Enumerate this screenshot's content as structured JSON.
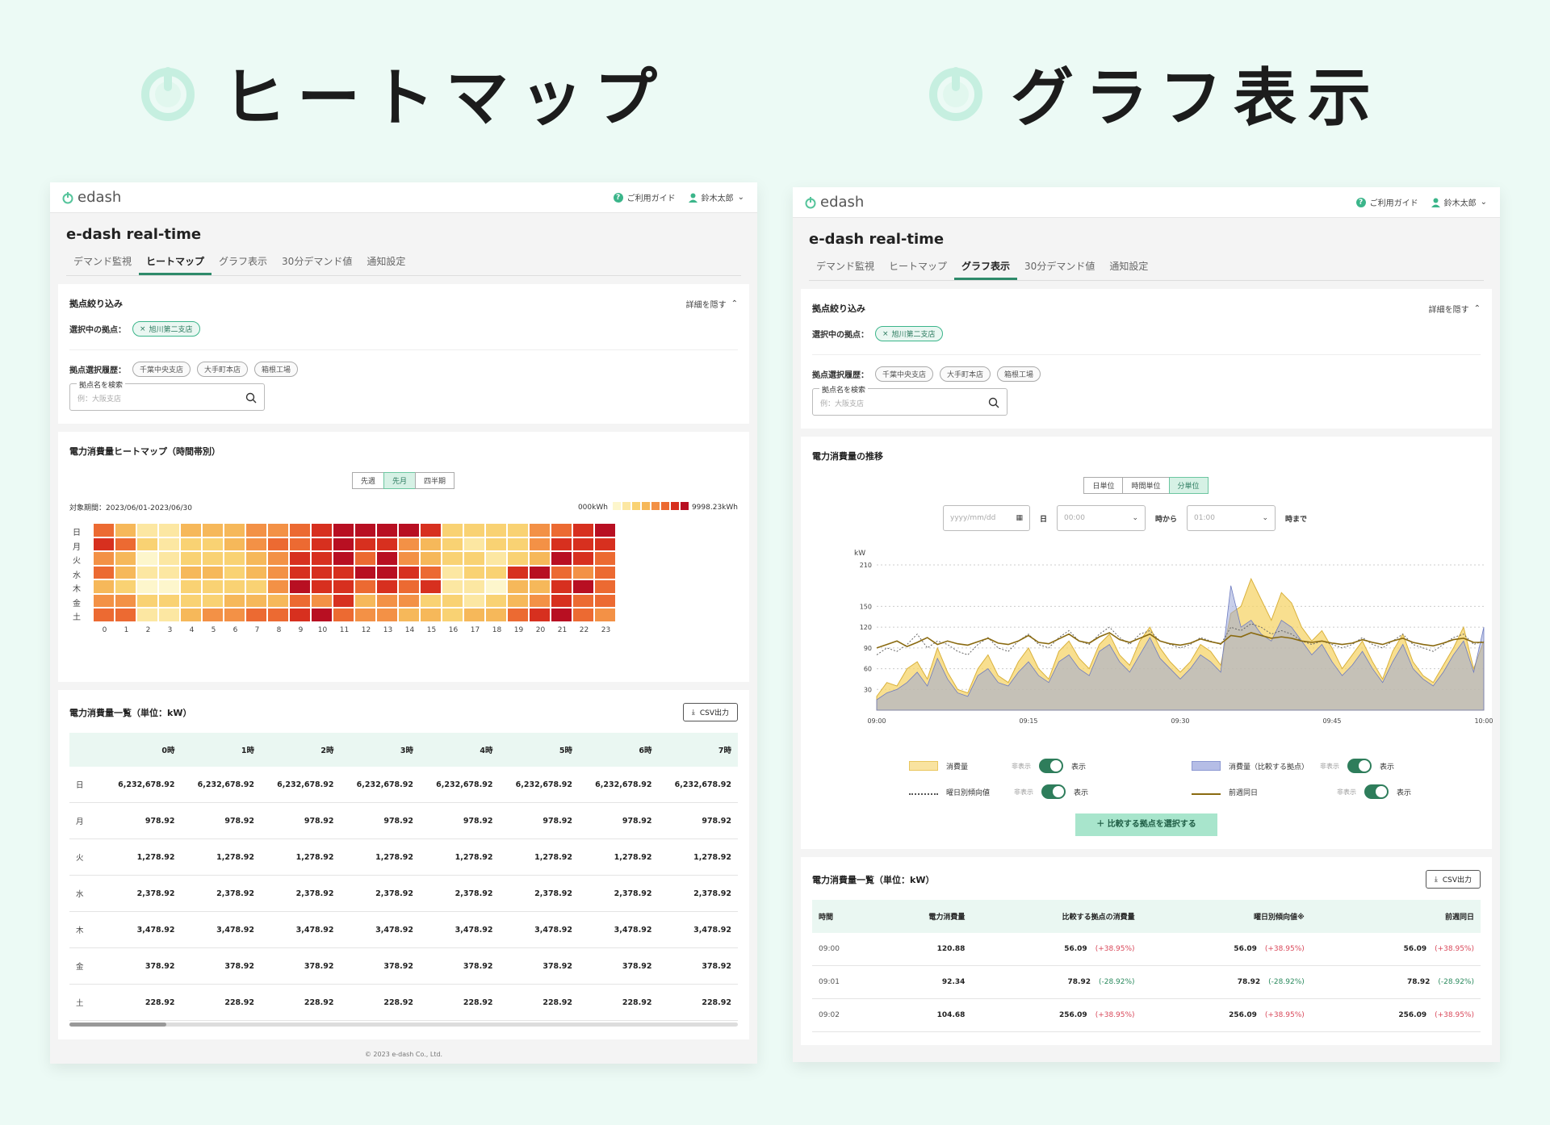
{
  "hero": {
    "left_title": "ヒートマップ",
    "right_title": "グラフ表示"
  },
  "app": {
    "brand": "edash",
    "guide": "ご利用ガイド",
    "user": "鈴木太郎",
    "title": "e-dash real-time",
    "tabs": [
      "デマンド監視",
      "ヒートマップ",
      "グラフ表示",
      "30分デマンド値",
      "通知設定"
    ]
  },
  "filter": {
    "title": "拠点絞り込み",
    "hide_detail": "詳細を隠す",
    "selected_label": "選択中の拠点：",
    "selected_chip": "旭川第二支店",
    "history_label": "拠点選択履歴：",
    "history_chips": [
      "千葉中央支店",
      "大手町本店",
      "箱根工場"
    ],
    "search_label": "拠点名を検索",
    "search_placeholder": "例：大阪支店"
  },
  "heatmap": {
    "title": "電力消費量ヒートマップ（時間帯別）",
    "periods": [
      "先週",
      "先月",
      "四半期"
    ],
    "active_period": 1,
    "range": "対象期間：2023/06/01-2023/06/30",
    "min_label": "000kWh",
    "max_label": "9998.23kWh",
    "scale_colors": [
      "#fdf6cc",
      "#fce7a2",
      "#f9d273",
      "#f6b85a",
      "#f39146",
      "#ec6a32",
      "#d7301f",
      "#b80f22"
    ],
    "days": [
      "日",
      "月",
      "火",
      "水",
      "木",
      "金",
      "土"
    ],
    "hours": [
      "0",
      "1",
      "2",
      "3",
      "4",
      "5",
      "6",
      "7",
      "8",
      "9",
      "10",
      "11",
      "12",
      "13",
      "14",
      "15",
      "16",
      "17",
      "18",
      "19",
      "20",
      "21",
      "22",
      "23"
    ],
    "levels": [
      [
        5,
        3,
        1,
        1,
        3,
        3,
        3,
        4,
        4,
        5,
        6,
        7,
        7,
        7,
        7,
        6,
        2,
        2,
        2,
        2,
        4,
        5,
        6,
        7
      ],
      [
        6,
        5,
        2,
        1,
        2,
        2,
        3,
        4,
        5,
        5,
        6,
        7,
        6,
        6,
        4,
        3,
        2,
        1,
        2,
        2,
        4,
        6,
        6,
        6
      ],
      [
        4,
        3,
        0,
        1,
        2,
        2,
        2,
        3,
        4,
        6,
        6,
        7,
        5,
        7,
        4,
        3,
        2,
        2,
        1,
        2,
        3,
        7,
        6,
        5
      ],
      [
        5,
        3,
        1,
        1,
        3,
        3,
        2,
        3,
        4,
        6,
        6,
        6,
        7,
        7,
        6,
        5,
        1,
        2,
        2,
        6,
        7,
        5,
        4,
        5
      ],
      [
        3,
        2,
        0,
        0,
        2,
        2,
        2,
        2,
        4,
        7,
        6,
        6,
        5,
        6,
        5,
        6,
        1,
        1,
        0,
        3,
        3,
        6,
        7,
        5
      ],
      [
        4,
        4,
        2,
        2,
        2,
        2,
        3,
        3,
        3,
        5,
        4,
        6,
        3,
        4,
        4,
        2,
        2,
        1,
        2,
        3,
        4,
        6,
        5,
        5
      ],
      [
        5,
        5,
        1,
        1,
        3,
        4,
        4,
        5,
        5,
        6,
        7,
        5,
        4,
        4,
        3,
        3,
        2,
        3,
        3,
        5,
        6,
        7,
        5,
        4
      ]
    ]
  },
  "usage_table": {
    "title": "電力消費量一覧（単位：kW）",
    "csv": "CSV出力",
    "headers": [
      "",
      "0時",
      "1時",
      "2時",
      "3時",
      "4時",
      "5時",
      "6時",
      "7時"
    ],
    "rows": [
      [
        "日",
        "6,232,678.92",
        "6,232,678.92",
        "6,232,678.92",
        "6,232,678.92",
        "6,232,678.92",
        "6,232,678.92",
        "6,232,678.92",
        "6,232,678.92"
      ],
      [
        "月",
        "978.92",
        "978.92",
        "978.92",
        "978.92",
        "978.92",
        "978.92",
        "978.92",
        "978.92"
      ],
      [
        "火",
        "1,278.92",
        "1,278.92",
        "1,278.92",
        "1,278.92",
        "1,278.92",
        "1,278.92",
        "1,278.92",
        "1,278.92"
      ],
      [
        "水",
        "2,378.92",
        "2,378.92",
        "2,378.92",
        "2,378.92",
        "2,378.92",
        "2,378.92",
        "2,378.92",
        "2,378.92"
      ],
      [
        "木",
        "3,478.92",
        "3,478.92",
        "3,478.92",
        "3,478.92",
        "3,478.92",
        "3,478.92",
        "3,478.92",
        "3,478.92"
      ],
      [
        "金",
        "378.92",
        "378.92",
        "378.92",
        "378.92",
        "378.92",
        "378.92",
        "378.92",
        "378.92"
      ],
      [
        "土",
        "228.92",
        "228.92",
        "228.92",
        "228.92",
        "228.92",
        "228.92",
        "228.92",
        "228.92"
      ]
    ]
  },
  "footer": "© 2023 e-dash Co., Ltd.",
  "graph": {
    "title": "電力消費量の推移",
    "units": [
      "日単位",
      "時間単位",
      "分単位"
    ],
    "active_unit": 2,
    "date_placeholder": "yyyy/mm/dd",
    "day_suffix": "日",
    "from_value": "00:00",
    "from_suffix": "時から",
    "to_value": "01:00",
    "to_suffix": "時まで",
    "legend": {
      "consumption": "消費量",
      "compare": "消費量（比較する拠点）",
      "weekday_trend": "曜日別傾向値",
      "prev_week": "前週同日",
      "hide": "非表示",
      "show": "表示"
    },
    "add_button": "比較する拠点を選択する"
  },
  "chart_data": {
    "type": "area",
    "ylabel": "kW",
    "yticks": [
      30,
      60,
      90,
      120,
      150,
      210
    ],
    "ylim": [
      0,
      210
    ],
    "xticks": [
      "09:00",
      "09:15",
      "09:30",
      "09:45",
      "10:00"
    ],
    "grid": true,
    "series": [
      {
        "name": "消費量",
        "values": [
          20,
          40,
          35,
          60,
          70,
          45,
          90,
          55,
          30,
          25,
          60,
          80,
          50,
          40,
          70,
          90,
          60,
          45,
          85,
          100,
          75,
          60,
          95,
          110,
          80,
          65,
          100,
          120,
          90,
          70,
          55,
          70,
          95,
          85,
          65,
          140,
          150,
          190,
          160,
          130,
          170,
          155,
          120,
          100,
          115,
          90,
          60,
          80,
          100,
          70,
          45,
          85,
          110,
          70,
          50,
          40,
          65,
          90,
          120,
          60,
          100
        ]
      },
      {
        "name": "消費量（比較する拠点）",
        "values": [
          15,
          25,
          30,
          40,
          55,
          35,
          75,
          45,
          25,
          20,
          50,
          60,
          40,
          35,
          55,
          70,
          50,
          40,
          70,
          80,
          60,
          50,
          85,
          95,
          70,
          55,
          80,
          105,
          75,
          60,
          45,
          60,
          80,
          70,
          55,
          180,
          120,
          130,
          110,
          100,
          130,
          120,
          100,
          80,
          95,
          70,
          50,
          65,
          85,
          60,
          40,
          70,
          95,
          60,
          45,
          35,
          55,
          80,
          100,
          55,
          120
        ]
      },
      {
        "name": "曜日別傾向値",
        "values": [
          80,
          90,
          85,
          95,
          110,
          90,
          100,
          95,
          85,
          80,
          95,
          105,
          90,
          85,
          100,
          110,
          95,
          90,
          105,
          115,
          100,
          95,
          110,
          120,
          105,
          95,
          110,
          115,
          100,
          95,
          90,
          95,
          105,
          100,
          95,
          120,
          115,
          125,
          120,
          110,
          115,
          110,
          100,
          95,
          100,
          95,
          90,
          95,
          105,
          95,
          90,
          100,
          110,
          95,
          90,
          85,
          95,
          105,
          110,
          95,
          100
        ]
      },
      {
        "name": "前週同日",
        "values": [
          90,
          95,
          100,
          92,
          98,
          105,
          95,
          100,
          96,
          94,
          99,
          104,
          97,
          95,
          100,
          108,
          98,
          96,
          103,
          110,
          100,
          97,
          106,
          112,
          102,
          98,
          104,
          110,
          100,
          96,
          94,
          97,
          103,
          99,
          96,
          108,
          106,
          112,
          108,
          104,
          106,
          104,
          100,
          98,
          100,
          97,
          95,
          97,
          102,
          98,
          95,
          100,
          104,
          98,
          95,
          93,
          97,
          102,
          104,
          98,
          98
        ]
      }
    ]
  },
  "graph_table": {
    "title": "電力消費量一覧（単位：kW）",
    "csv": "CSV出力",
    "headers": [
      "時間",
      "電力消費量",
      "比較する拠点の消費量",
      "曜日別傾向値※",
      "前週同日"
    ],
    "rows": [
      {
        "time": "09:00",
        "usage": "120.88",
        "compare": "56.09",
        "compare_pct": "(+38.95%)",
        "compare_dir": "up",
        "trend": "56.09",
        "trend_pct": "(+38.95%)",
        "trend_dir": "up",
        "prev": "56.09",
        "prev_pct": "(+38.95%)",
        "prev_dir": "up"
      },
      {
        "time": "09:01",
        "usage": "92.34",
        "compare": "78.92",
        "compare_pct": "(-28.92%)",
        "compare_dir": "down",
        "trend": "78.92",
        "trend_pct": "(-28.92%)",
        "trend_dir": "down",
        "prev": "78.92",
        "prev_pct": "(-28.92%)",
        "prev_dir": "down"
      },
      {
        "time": "09:02",
        "usage": "104.68",
        "compare": "256.09",
        "compare_pct": "(+38.95%)",
        "compare_dir": "up",
        "trend": "256.09",
        "trend_pct": "(+38.95%)",
        "trend_dir": "up",
        "prev": "256.09",
        "prev_pct": "(+38.95%)",
        "prev_dir": "up"
      }
    ]
  },
  "colors": {
    "accent": "#2e8a6a",
    "mint_bg": "#ecfaf5",
    "consumption_fill": "#f5d46a",
    "compare_fill": "#9aa7d8",
    "prev_week_line": "#8a6a10"
  }
}
